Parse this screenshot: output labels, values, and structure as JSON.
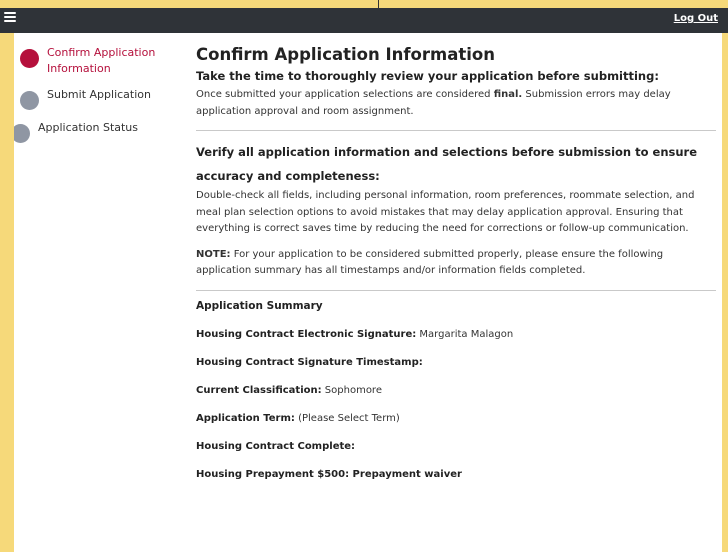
{
  "navbar": {
    "logout_label": "Log Out"
  },
  "sidebar": {
    "steps": [
      {
        "label": "Confirm Application Information",
        "active": true
      },
      {
        "label": "Submit Application",
        "active": false
      },
      {
        "label": "Application Status",
        "active": false
      }
    ]
  },
  "main": {
    "title": "Confirm Application Information",
    "subtitle": "Take the time to thoroughly review your application before submitting:",
    "intro_before": "Once submitted your application selections are considered ",
    "intro_bold": "final.",
    "intro_after": " Submission errors may delay application approval and room assignment.",
    "verify_heading_line1": "Verify all application information and selections before submission to ensure",
    "verify_heading_line2": "accuracy and completeness:",
    "verify_text": "Double-check all fields, including personal information, room preferences, roommate selection, and meal plan selection options to avoid mistakes that may delay application approval. Ensuring that everything is correct saves time by reducing the need for corrections or follow-up communication.",
    "note_label": "NOTE:",
    "note_text": " For your application to be considered submitted properly, please ensure the following application summary has all timestamps and/or information fields completed."
  },
  "summary": {
    "title": "Application Summary",
    "rows": [
      {
        "label": "Housing Contract Electronic Signature:",
        "value": " Margarita Malagon"
      },
      {
        "label": "Housing Contract Signature Timestamp:",
        "value": ""
      },
      {
        "label": "Current Classification:",
        "value": " Sophomore"
      },
      {
        "label": "Application Term:",
        "value": " (Please Select Term)"
      },
      {
        "label": "Housing Contract Complete:",
        "value": ""
      },
      {
        "label": "Housing Prepayment $500:",
        "value": " Prepayment waiver"
      }
    ]
  },
  "colors": {
    "navbar": "#2f3338",
    "accent": "#b5103c",
    "inactive_step": "#8f96a3",
    "background": "#f6d97a"
  }
}
